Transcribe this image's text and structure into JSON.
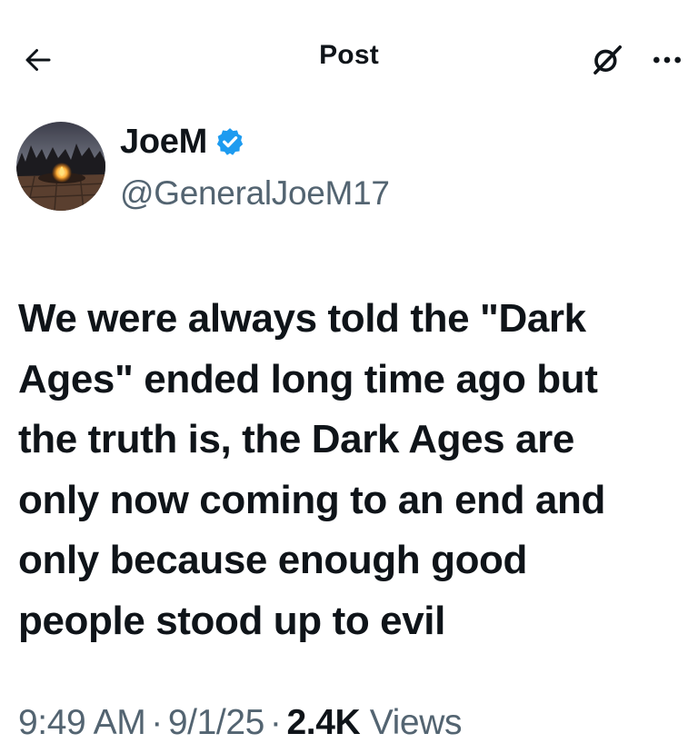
{
  "header": {
    "title": "Post",
    "back_icon": "arrow-left-icon",
    "grok_icon": "grok-icon",
    "more_icon": "more-horizontal-icon"
  },
  "author": {
    "display_name": "JoeM",
    "handle": "@GeneralJoeM17",
    "verified": true,
    "verified_color": "#1d9bf0",
    "avatar_icon": "avatar-photo"
  },
  "tweet": {
    "text": "We were always told the \"Dark\nAges\" ended long time ago but\nthe truth is, the Dark Ages are\nonly now coming to an end and\nonly because enough good\npeople stood up to evil"
  },
  "meta": {
    "time": "9:49 AM",
    "separator": "·",
    "date": "9/1/25",
    "views_count": "2.4K",
    "views_label": "Views"
  },
  "colors": {
    "text_primary": "#0f1419",
    "text_secondary": "#536471",
    "accent": "#1d9bf0",
    "background": "#ffffff"
  }
}
